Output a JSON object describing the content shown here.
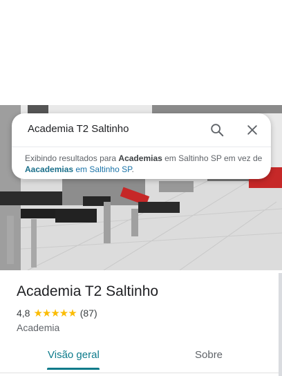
{
  "search": {
    "query": "Academia T2 Saltinho",
    "search_icon": "search-icon",
    "close_icon": "close-icon"
  },
  "suggestion": {
    "prefix": "Exibindo resultados para ",
    "corrected": "Academias",
    "middle": " em Saltinho SP em vez de ",
    "original": "Aacademias",
    "original_suffix": " em Saltinho SP",
    "end": "."
  },
  "place": {
    "name": "Academia T2 Saltinho",
    "rating": "4,8",
    "stars": "★★★★★",
    "reviews": "(87)",
    "category": "Academia"
  },
  "tabs": [
    {
      "label": "Visão geral",
      "active": true
    },
    {
      "label": "Sobre",
      "active": false
    }
  ],
  "colors": {
    "accent": "#0b7a8a",
    "star": "#fbbc04"
  }
}
